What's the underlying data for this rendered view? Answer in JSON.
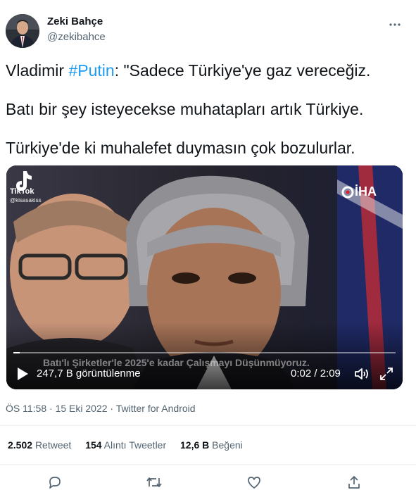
{
  "author": {
    "name": "Zeki Bahçe",
    "handle": "@zekibahce"
  },
  "tweet": {
    "line1_prefix": "Vladimir ",
    "line1_hashtag": "#Putin",
    "line1_suffix": ": \"Sadece Türkiye'ye gaz vereceğiz.",
    "line2": "Batı bir şey isteyecekse muhatapları artık Türkiye.",
    "line3": "Türkiye'de ki muhalefet duymasın çok bozulurlar."
  },
  "video": {
    "tiktok_label": "TikTok",
    "tiktok_user": "@kisasakiss",
    "iha_logo": "İHA",
    "subtitle": "Batı'lı Şirketler'le 2025'e kadar Çalışmayı Düşünmüyoruz.",
    "views": "247,7 B görüntülenme",
    "time": "0:02 / 2:09",
    "progress": 0.016
  },
  "meta": {
    "time": "ÖS 11:58",
    "date": "15 Eki 2022",
    "source": "Twitter for Android"
  },
  "stats": {
    "retweets_count": "2.502",
    "retweets_label": "Retweet",
    "quotes_count": "154",
    "quotes_label": "Alıntı Tweetler",
    "likes_count": "12,6 B",
    "likes_label": "Beğeni"
  },
  "icons": {
    "more": "more-icon",
    "reply": "reply-icon",
    "retweet": "retweet-icon",
    "like": "heart-icon",
    "share": "share-icon",
    "play": "play-icon",
    "volume": "volume-icon",
    "fullscreen": "fullscreen-icon"
  },
  "colors": {
    "accent": "#1d9bf0",
    "secondary_text": "#536471",
    "primary_text": "#0f1419"
  }
}
